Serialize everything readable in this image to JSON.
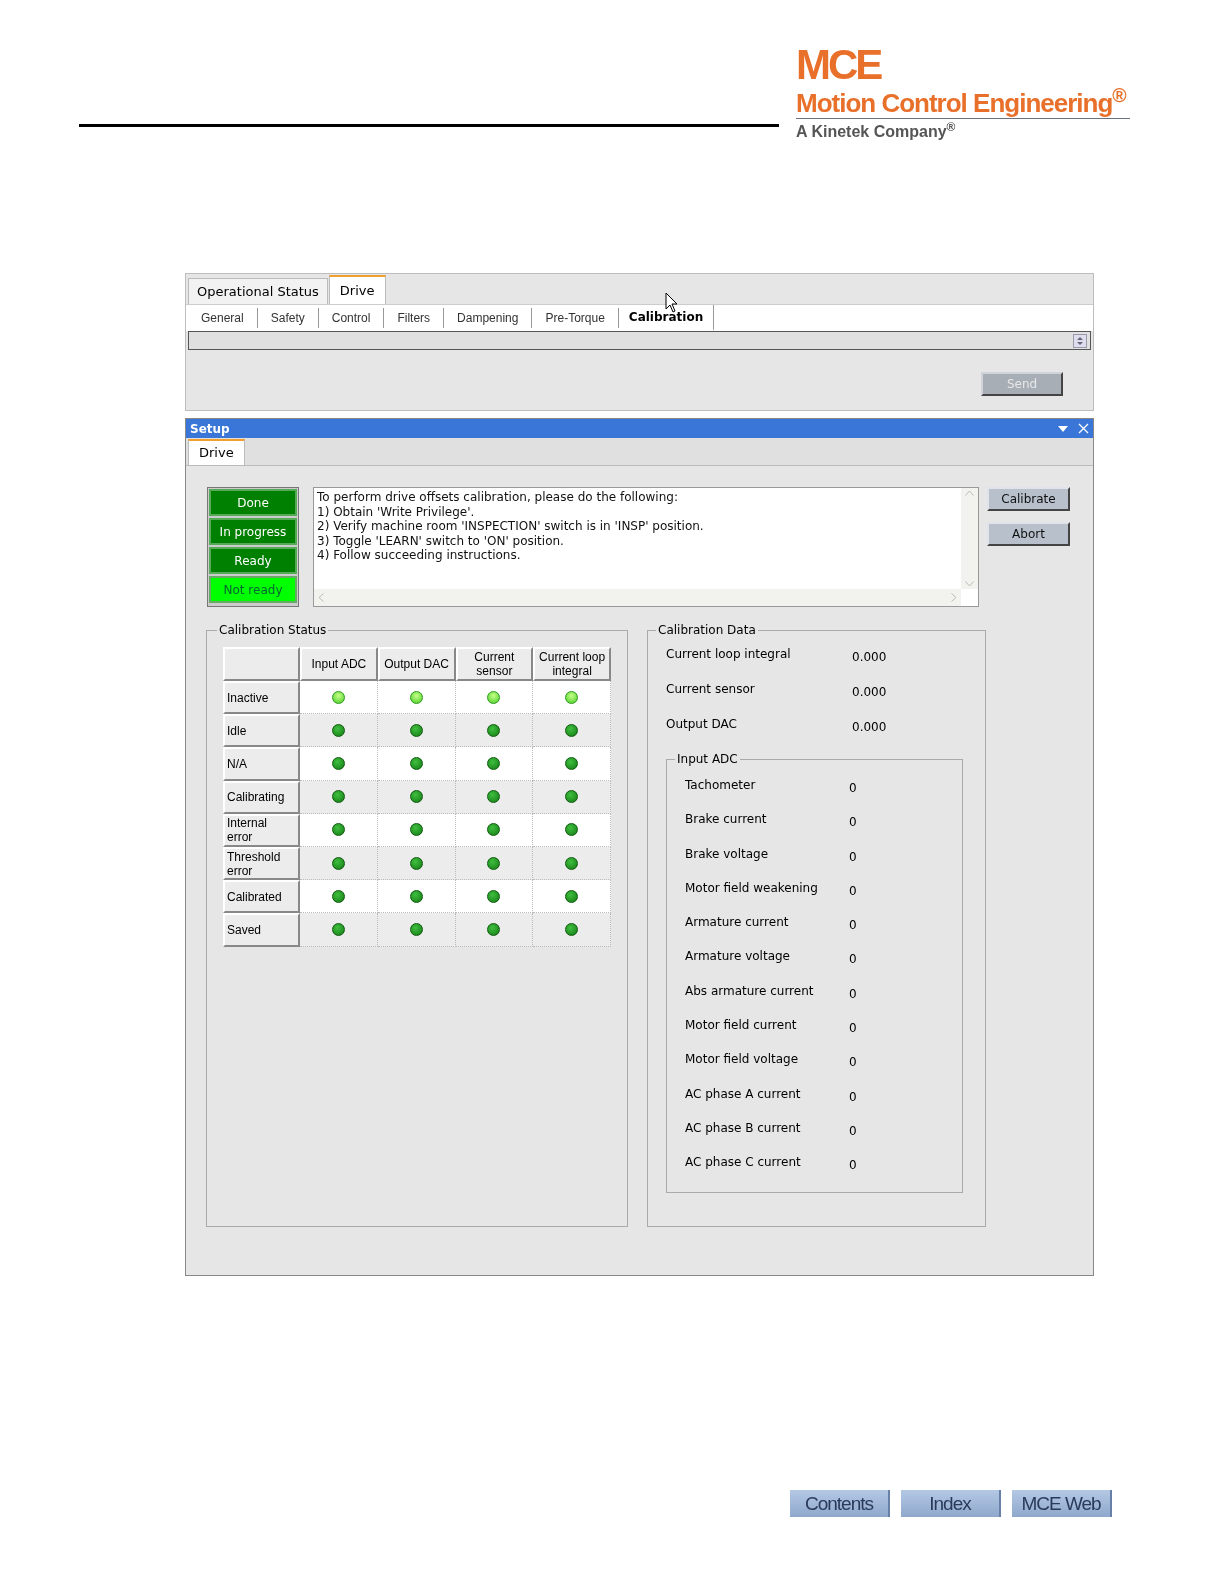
{
  "logo": {
    "mark": "MCE",
    "name": "Motion Control Engineering$^{®}$",
    "tagline": "A Kinetek Company$^{®}$"
  },
  "main_tabs": [
    {
      "label": "Operational Status",
      "selected": false
    },
    {
      "label": "Drive",
      "selected": true
    }
  ],
  "sub_tabs": [
    {
      "label": "General",
      "selected": false
    },
    {
      "label": "Safety",
      "selected": false
    },
    {
      "label": "Control",
      "selected": false
    },
    {
      "label": "Filters",
      "selected": false
    },
    {
      "label": "Dampening",
      "selected": false
    },
    {
      "label": "Pre-Torque",
      "selected": false
    },
    {
      "label": "Calibration",
      "selected": true
    }
  ],
  "send_button": "Send",
  "setup_window": {
    "title": "Setup",
    "tabs": [
      {
        "label": "Drive",
        "selected": true
      }
    ],
    "status_lamps": [
      {
        "label": "Done",
        "lit": false
      },
      {
        "label": "In progress",
        "lit": false
      },
      {
        "label": "Ready",
        "lit": false
      },
      {
        "label": "Not ready",
        "lit": true
      }
    ],
    "instructions": [
      "To perform drive offsets calibration, please do the following:",
      "1) Obtain 'Write Privilege'.",
      "2) Verify machine room 'INSPECTION' switch is in 'INSP' position.",
      "3) Toggle 'LEARN' switch to 'ON' position.",
      "4) Follow succeeding instructions."
    ],
    "buttons": [
      "Calibrate",
      "Abort"
    ],
    "calibration_status": {
      "title": "Calibration Status",
      "columns": [
        "Input ADC",
        "Output DAC",
        "Current sensor",
        "Current loop integral"
      ],
      "rows": [
        {
          "label": "Inactive",
          "cells": [
            {
              "lit": true
            },
            {
              "lit": true
            },
            {
              "lit": true
            },
            {
              "lit": true
            }
          ]
        },
        {
          "label": "Idle",
          "cells": [
            {
              "lit": false
            },
            {
              "lit": false
            },
            {
              "lit": false
            },
            {
              "lit": false
            }
          ]
        },
        {
          "label": "N/A",
          "cells": [
            {
              "lit": false
            },
            {
              "lit": false
            },
            {
              "lit": false
            },
            {
              "lit": false
            }
          ]
        },
        {
          "label": "Calibrating",
          "cells": [
            {
              "lit": false
            },
            {
              "lit": false
            },
            {
              "lit": false
            },
            {
              "lit": false
            }
          ]
        },
        {
          "label": "Internal error",
          "cells": [
            {
              "lit": false
            },
            {
              "lit": false
            },
            {
              "lit": false
            },
            {
              "lit": false
            }
          ]
        },
        {
          "label": "Threshold error",
          "cells": [
            {
              "lit": false
            },
            {
              "lit": false
            },
            {
              "lit": false
            },
            {
              "lit": false
            }
          ]
        },
        {
          "label": "Calibrated",
          "cells": [
            {
              "lit": false
            },
            {
              "lit": false
            },
            {
              "lit": false
            },
            {
              "lit": false
            }
          ]
        },
        {
          "label": "Saved",
          "cells": [
            {
              "lit": false
            },
            {
              "lit": false
            },
            {
              "lit": false
            },
            {
              "lit": false
            }
          ]
        }
      ]
    },
    "calibration_data": {
      "title": "Calibration Data",
      "rows": [
        {
          "label": "Current loop integral",
          "value": "0.000"
        },
        {
          "label": "Current sensor",
          "value": "0.000"
        },
        {
          "label": "Output DAC",
          "value": "0.000"
        }
      ],
      "input_adc": {
        "title": "Input ADC",
        "rows": [
          {
            "label": "Tachometer",
            "value": "0"
          },
          {
            "label": "Brake current",
            "value": "0"
          },
          {
            "label": "Brake voltage",
            "value": "0"
          },
          {
            "label": "Motor field weakening",
            "value": "0"
          },
          {
            "label": "Armature current",
            "value": "0"
          },
          {
            "label": "Armature voltage",
            "value": "0"
          },
          {
            "label": "Abs armature current",
            "value": "0"
          },
          {
            "label": "Motor field current",
            "value": "0"
          },
          {
            "label": "Motor field voltage",
            "value": "0"
          },
          {
            "label": "AC phase A current",
            "value": "0"
          },
          {
            "label": "AC phase B current",
            "value": "0"
          },
          {
            "label": "AC phase C current",
            "value": "0"
          }
        ]
      }
    }
  },
  "footer_buttons": [
    "Contents",
    "Index",
    "MCE Web"
  ]
}
